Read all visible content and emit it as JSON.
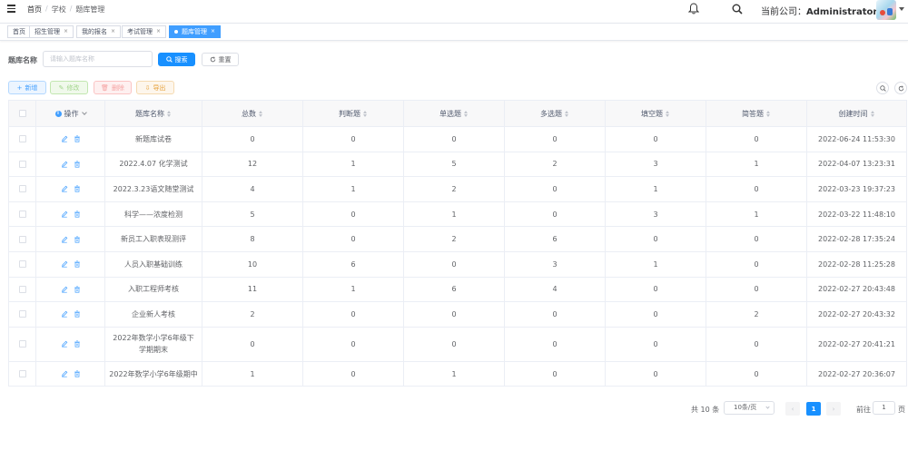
{
  "breadcrumb": [
    "首页",
    "学校",
    "题库管理"
  ],
  "header": {
    "company_label": "当前公司：",
    "company_name": "Administrator"
  },
  "tags": [
    {
      "label": "首页",
      "closable": false,
      "active": false
    },
    {
      "label": "招生管理",
      "closable": true,
      "active": false
    },
    {
      "label": "我的报名",
      "closable": true,
      "active": false
    },
    {
      "label": "考试管理",
      "closable": true,
      "active": false
    },
    {
      "label": "题库管理",
      "closable": true,
      "active": true
    }
  ],
  "search": {
    "label": "题库名称",
    "placeholder": "请输入题库名称",
    "search_btn": "搜索",
    "reset_btn": "重置"
  },
  "toolbar": {
    "add": "新增",
    "edit": "修改",
    "delete": "删除",
    "export": "导出"
  },
  "table": {
    "headers": [
      "操作",
      "题库名称",
      "总数",
      "判断题",
      "单选题",
      "多选题",
      "填空题",
      "简答题",
      "创建时间"
    ],
    "rows": [
      {
        "name": "新题库试卷",
        "total": "0",
        "judge": "0",
        "single": "0",
        "multi": "0",
        "fill": "0",
        "short": "0",
        "created": "2022-06-24 11:53:30"
      },
      {
        "name": "2022.4.07 化学测试",
        "total": "12",
        "judge": "1",
        "single": "5",
        "multi": "2",
        "fill": "3",
        "short": "1",
        "created": "2022-04-07 13:23:31"
      },
      {
        "name": "2022.3.23语文随堂测试",
        "total": "4",
        "judge": "1",
        "single": "2",
        "multi": "0",
        "fill": "1",
        "short": "0",
        "created": "2022-03-23 19:37:23"
      },
      {
        "name": "科学——浓度检测",
        "total": "5",
        "judge": "0",
        "single": "1",
        "multi": "0",
        "fill": "3",
        "short": "1",
        "created": "2022-03-22 11:48:10"
      },
      {
        "name": "新员工入职表现测评",
        "total": "8",
        "judge": "0",
        "single": "2",
        "multi": "6",
        "fill": "0",
        "short": "0",
        "created": "2022-02-28 17:35:24"
      },
      {
        "name": "人员入职基础训练",
        "total": "10",
        "judge": "6",
        "single": "0",
        "multi": "3",
        "fill": "1",
        "short": "0",
        "created": "2022-02-28 11:25:28"
      },
      {
        "name": "入职工程师考核",
        "total": "11",
        "judge": "1",
        "single": "6",
        "multi": "4",
        "fill": "0",
        "short": "0",
        "created": "2022-02-27 20:43:48"
      },
      {
        "name": "企业新人考核",
        "total": "2",
        "judge": "0",
        "single": "0",
        "multi": "0",
        "fill": "0",
        "short": "2",
        "created": "2022-02-27 20:43:32"
      },
      {
        "name": "2022年数学小学6年级下学期期末",
        "total": "0",
        "judge": "0",
        "single": "0",
        "multi": "0",
        "fill": "0",
        "short": "0",
        "created": "2022-02-27 20:41:21"
      },
      {
        "name": "2022年数学小学6年级期中",
        "total": "1",
        "judge": "0",
        "single": "1",
        "multi": "0",
        "fill": "0",
        "short": "0",
        "created": "2022-02-27 20:36:07"
      }
    ]
  },
  "pagination": {
    "total": "共 10 条",
    "page_size": "10条/页",
    "current": "1",
    "goto_label": "前往",
    "goto_value": "1",
    "page_label": "页"
  }
}
